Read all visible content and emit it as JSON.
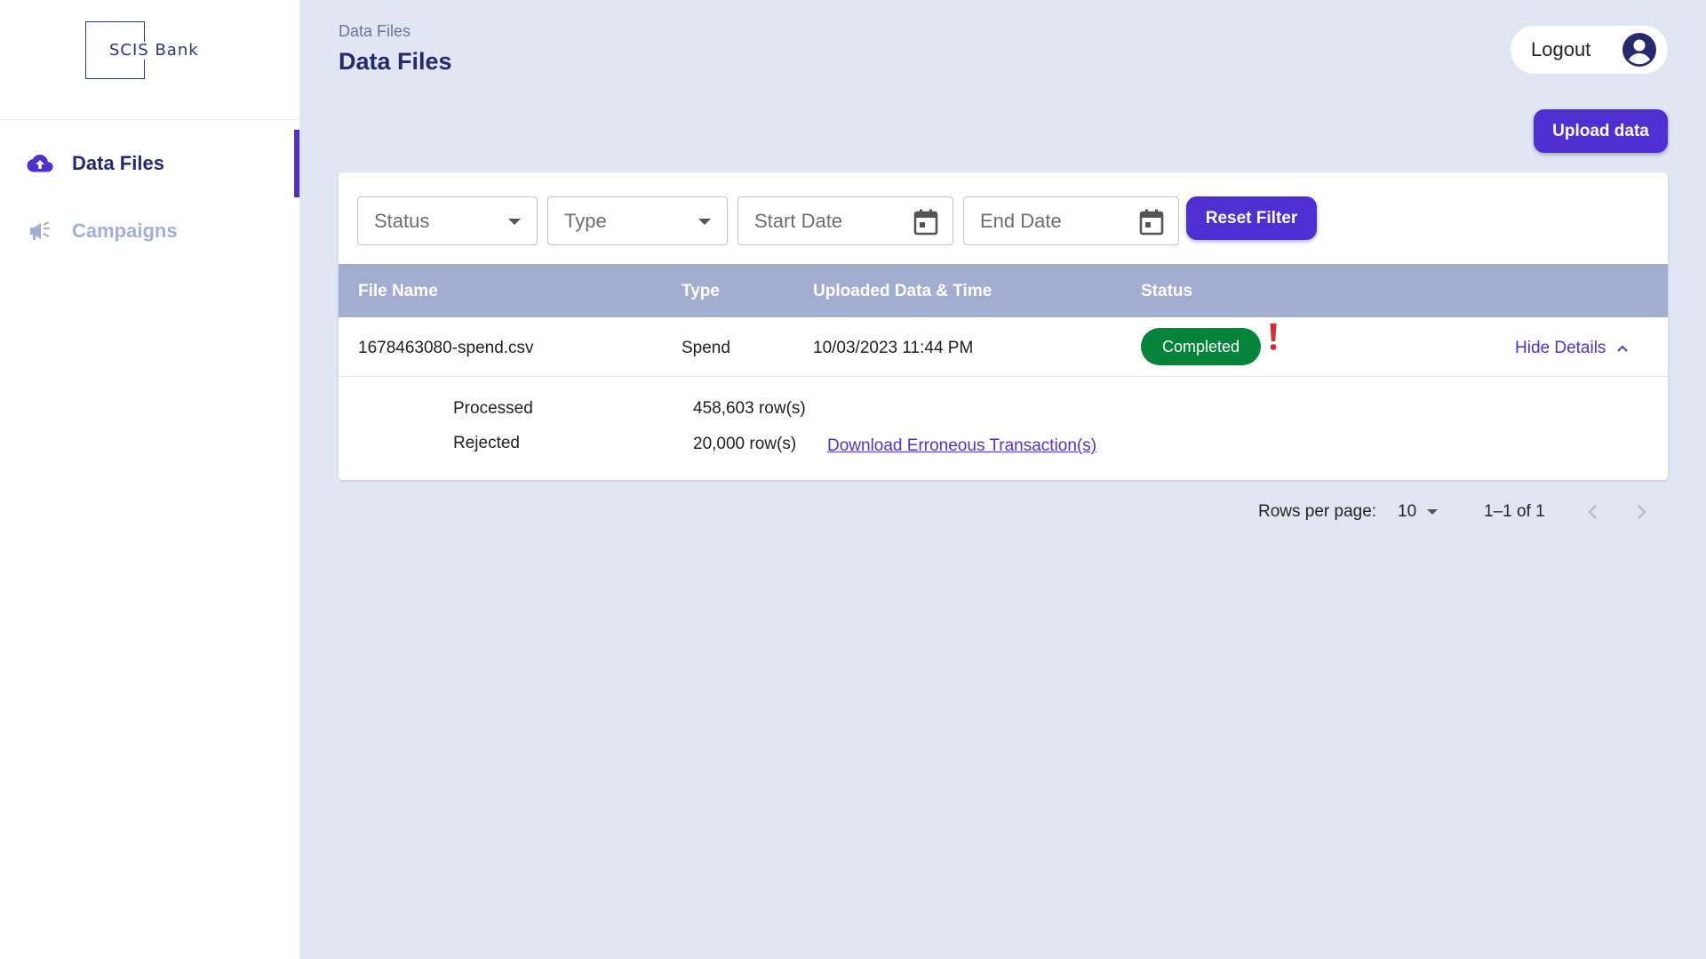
{
  "brand": {
    "logo_text": "SCIS Bank"
  },
  "sidebar": {
    "items": [
      {
        "label": "Data Files",
        "icon": "cloud-upload-icon",
        "active": true
      },
      {
        "label": "Campaigns",
        "icon": "megaphone-icon",
        "active": false
      }
    ]
  },
  "header": {
    "breadcrumb": "Data Files",
    "title": "Data Files",
    "logout_label": "Logout",
    "upload_label": "Upload data"
  },
  "filters": {
    "status_label": "Status",
    "type_label": "Type",
    "start_date_label": "Start Date",
    "end_date_label": "End Date",
    "reset_label": "Reset Filter"
  },
  "table": {
    "columns": [
      "File Name",
      "Type",
      "Uploaded Data & Time",
      "Status"
    ],
    "rows": [
      {
        "file_name": "1678463080-spend.csv",
        "type": "Spend",
        "uploaded": "10/03/2023 11:44 PM",
        "status": "Completed",
        "toggle_label": "Hide Details",
        "details": {
          "processed_label": "Processed",
          "processed_value": "458,603 row(s)",
          "rejected_label": "Rejected",
          "rejected_value": "20,000 row(s)",
          "download_label": "Download Erroneous Transaction(s)"
        }
      }
    ]
  },
  "pagination": {
    "rows_per_page_label": "Rows per page:",
    "rows_per_page_value": "10",
    "range": "1–1 of 1"
  },
  "colors": {
    "accent": "#4f2fd1",
    "navy": "#242a6b",
    "success": "#03843a",
    "alert": "#d32f2f",
    "header_row": "#a3adcf",
    "background": "#e0e6f2"
  }
}
